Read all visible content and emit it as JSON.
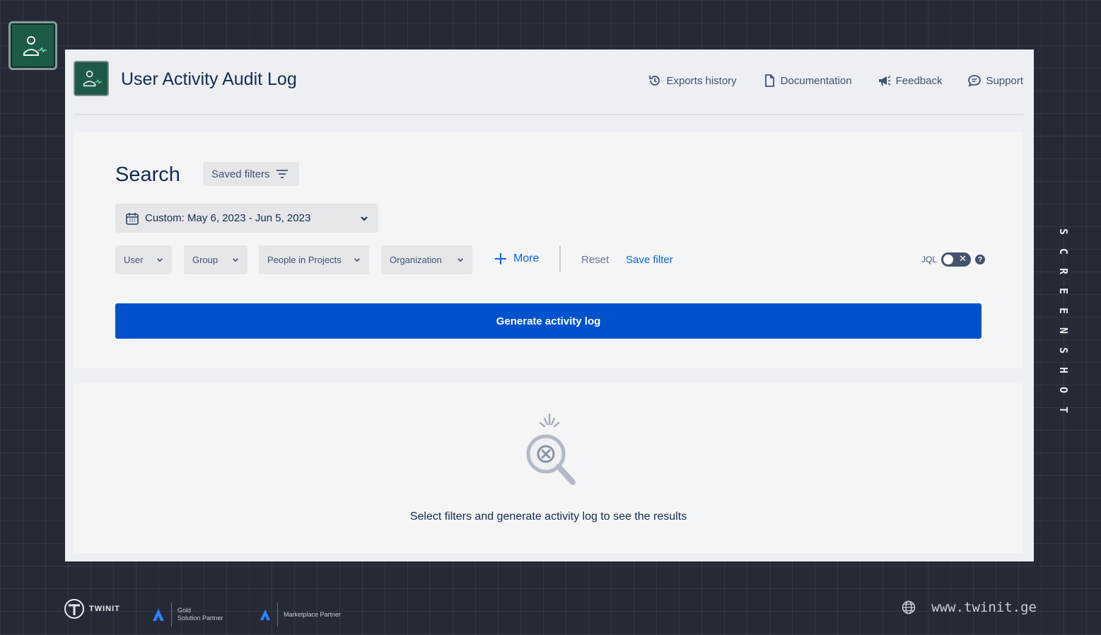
{
  "app": {
    "title": "User Activity Audit Log"
  },
  "header_nav": [
    {
      "label": "Exports history",
      "icon": "history-icon"
    },
    {
      "label": "Documentation",
      "icon": "document-icon"
    },
    {
      "label": "Feedback",
      "icon": "megaphone-icon"
    },
    {
      "label": "Support",
      "icon": "chat-icon"
    }
  ],
  "search": {
    "title": "Search",
    "saved_filters_label": "Saved filters",
    "date_range": "Custom: May 6, 2023 - Jun 5, 2023",
    "filters": [
      {
        "label": "User"
      },
      {
        "label": "Group"
      },
      {
        "label": "People in Projects"
      },
      {
        "label": "Organization"
      }
    ],
    "more_label": "More",
    "reset_label": "Reset",
    "save_filter_label": "Save filter",
    "jql_label": "JQL",
    "jql_enabled": false,
    "generate_label": "Generate activity log"
  },
  "results": {
    "empty_message": "Select filters and generate activity log to see the results"
  },
  "side_label": [
    "S",
    "C",
    "R",
    "E",
    "E",
    "N",
    "S",
    "H",
    "O",
    "T"
  ],
  "footer": {
    "brand": "TWINIT",
    "partner1_line1": "Gold",
    "partner1_line2": "Solution Partner",
    "partner2": "Marketplace Partner",
    "website": "www.twinit.ge"
  },
  "colors": {
    "primary": "#0052cc",
    "link": "#0c66e4",
    "page_background": "#262a36",
    "card_background": "#f4f5f7"
  }
}
